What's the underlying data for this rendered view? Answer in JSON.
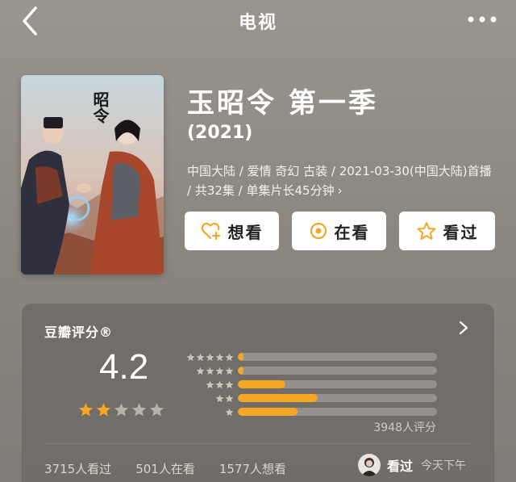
{
  "header": {
    "title": "电视"
  },
  "show": {
    "title": "玉昭令 第一季",
    "year": "(2021)",
    "meta": "中国大陆 / 爱情 奇幻 古装 / 2021-03-30(中国大陆)首播 / 共32集 / 单集片长45分钟",
    "poster_calligraphy": "昭令"
  },
  "actions": {
    "want_label": "想看",
    "watching_label": "在看",
    "watched_label": "看过"
  },
  "rating": {
    "header": "豆瓣评分®",
    "score": "4.2",
    "stars_filled": 2,
    "stars_total": 5,
    "count_text": "3948人评分",
    "distribution": [
      {
        "stars": 5,
        "fraction": 0.03
      },
      {
        "stars": 4,
        "fraction": 0.03
      },
      {
        "stars": 3,
        "fraction": 0.24
      },
      {
        "stars": 2,
        "fraction": 0.4
      },
      {
        "stars": 1,
        "fraction": 0.3
      }
    ]
  },
  "stats": {
    "watched": "3715人看过",
    "watching": "501人在看",
    "want": "1577人想看"
  },
  "review": {
    "status": "看过",
    "time": "今天下午"
  },
  "colors": {
    "accent": "#f5a623",
    "button_bg": "#ffffff",
    "track": "#a09c97"
  }
}
